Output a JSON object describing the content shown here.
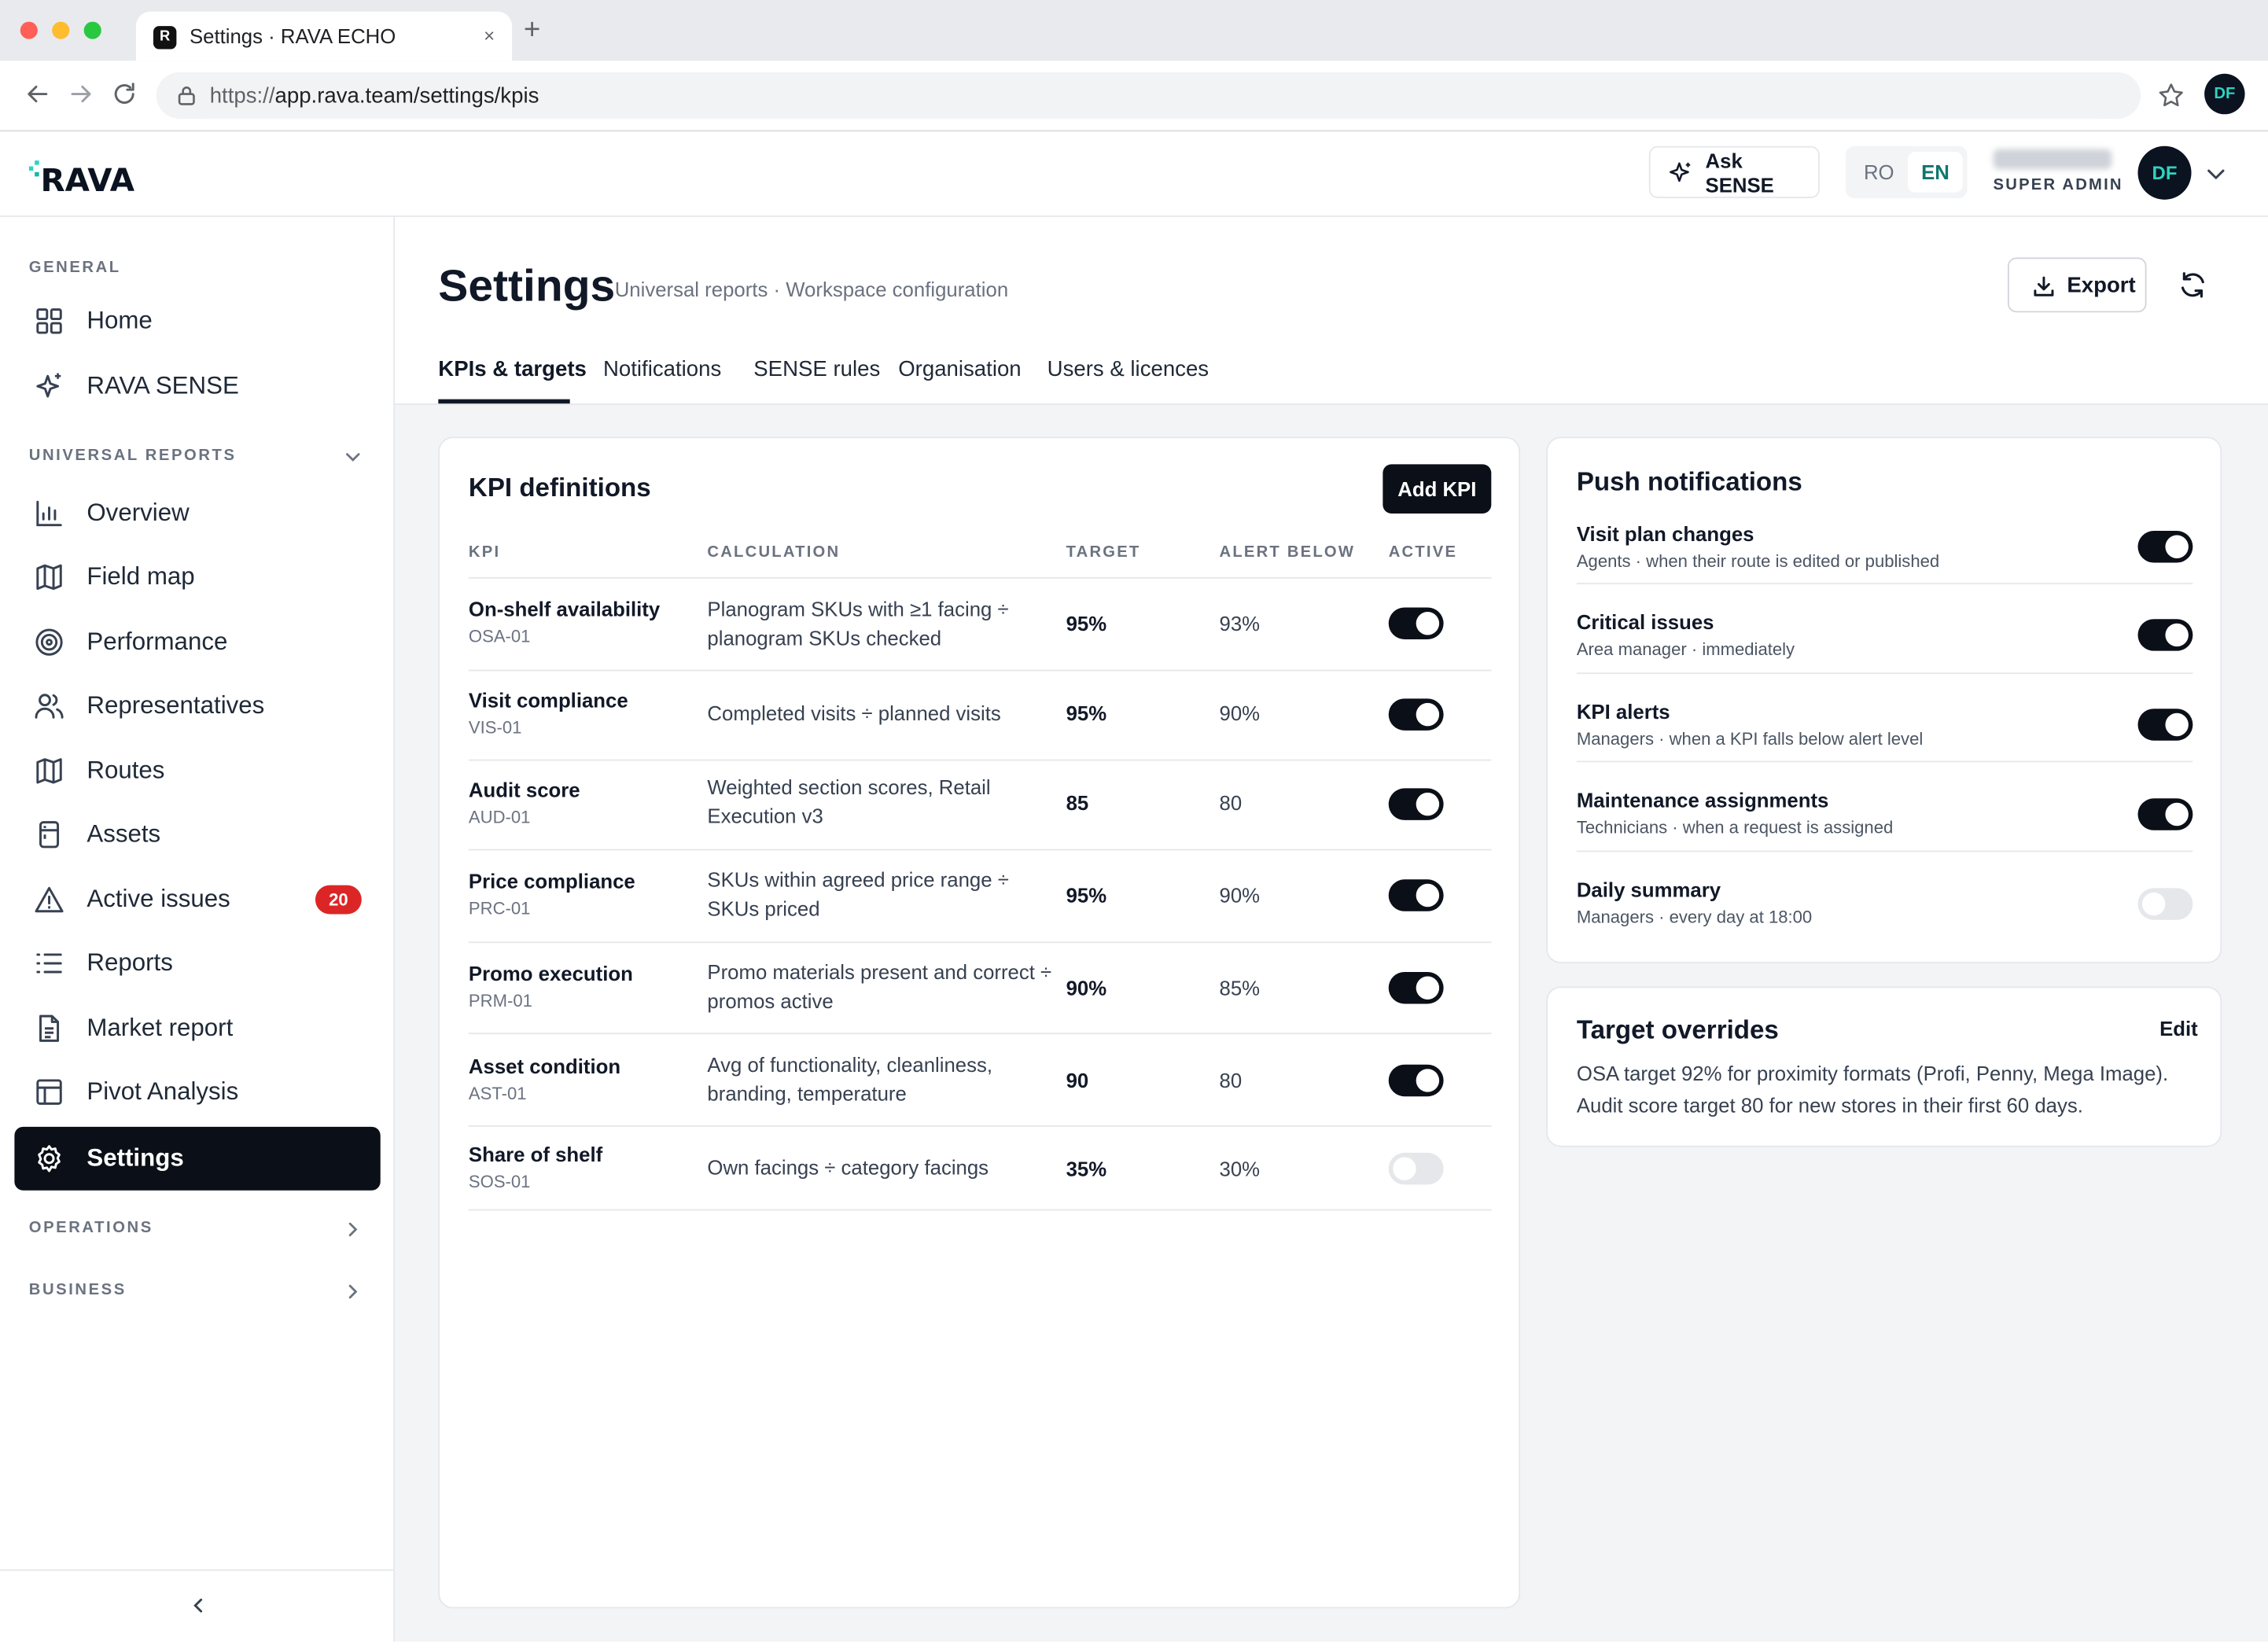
{
  "browser": {
    "tab_title": "Settings · RAVA ECHO",
    "tab_close": "×",
    "new_tab": "+",
    "url_scheme": "https://",
    "url_rest": "app.rava.team/settings/kpis",
    "profile_initials": "DF",
    "favicon_letter": "R"
  },
  "header": {
    "logo_text": "RAVA",
    "ask_line1": "Ask",
    "ask_line2": "SENSE",
    "lang_ro": "RO",
    "lang_en": "EN",
    "user_role": "SUPER ADMIN",
    "avatar_initials": "DF"
  },
  "sidebar": {
    "general_label": "GENERAL",
    "universal_label": "UNIVERSAL REPORTS",
    "operations_label": "OPERATIONS",
    "business_label": "BUSINESS",
    "items": [
      {
        "label": "Home"
      },
      {
        "label": "RAVA SENSE"
      },
      {
        "label": "Overview"
      },
      {
        "label": "Field map"
      },
      {
        "label": "Performance"
      },
      {
        "label": "Representatives"
      },
      {
        "label": "Routes"
      },
      {
        "label": "Assets"
      },
      {
        "label": "Active issues",
        "badge": "20"
      },
      {
        "label": "Reports"
      },
      {
        "label": "Market report"
      },
      {
        "label": "Pivot Analysis"
      },
      {
        "label": "Settings"
      }
    ]
  },
  "page": {
    "title": "Settings",
    "subtitle": "Universal reports · Workspace configuration",
    "export_label": "Export",
    "tabs": [
      {
        "label": "KPIs & targets"
      },
      {
        "label": "Notifications"
      },
      {
        "label": "SENSE rules"
      },
      {
        "label": "Organisation"
      },
      {
        "label": "Users & licences"
      }
    ]
  },
  "kpi": {
    "title": "KPI definitions",
    "add_label": "Add KPI",
    "columns": {
      "kpi": "KPI",
      "calculation": "CALCULATION",
      "target": "TARGET",
      "alert": "ALERT BELOW",
      "active": "ACTIVE"
    },
    "rows": [
      {
        "name": "On-shelf availability",
        "code": "OSA-01",
        "calc": "Planogram SKUs with ≥1 facing ÷ planogram SKUs checked",
        "target": "95%",
        "alert": "93%",
        "active": true
      },
      {
        "name": "Visit compliance",
        "code": "VIS-01",
        "calc": "Completed visits ÷ planned visits",
        "target": "95%",
        "alert": "90%",
        "active": true
      },
      {
        "name": "Audit score",
        "code": "AUD-01",
        "calc": "Weighted section scores, Retail Execution v3",
        "target": "85",
        "alert": "80",
        "active": true
      },
      {
        "name": "Price compliance",
        "code": "PRC-01",
        "calc": "SKUs within agreed price range ÷ SKUs priced",
        "target": "95%",
        "alert": "90%",
        "active": true
      },
      {
        "name": "Promo execution",
        "code": "PRM-01",
        "calc": "Promo materials present and correct ÷ promos active",
        "target": "90%",
        "alert": "85%",
        "active": true
      },
      {
        "name": "Asset condition",
        "code": "AST-01",
        "calc": "Avg of functionality, cleanliness, branding, temperature",
        "target": "90",
        "alert": "80",
        "active": true
      },
      {
        "name": "Share of shelf",
        "code": "SOS-01",
        "calc": "Own facings ÷ category facings",
        "target": "35%",
        "alert": "30%",
        "active": false
      }
    ]
  },
  "push": {
    "title": "Push notifications",
    "items": [
      {
        "title": "Visit plan changes",
        "desc": "Agents · when their route is edited or published",
        "on": true
      },
      {
        "title": "Critical issues",
        "desc": "Area manager · immediately",
        "on": true
      },
      {
        "title": "KPI alerts",
        "desc": "Managers · when a KPI falls below alert level",
        "on": true
      },
      {
        "title": "Maintenance assignments",
        "desc": "Technicians · when a request is assigned",
        "on": true
      },
      {
        "title": "Daily summary",
        "desc": "Managers · every day at 18:00",
        "on": false
      }
    ]
  },
  "overrides": {
    "title": "Target overrides",
    "edit_label": "Edit",
    "text": "OSA target 92% for proximity formats (Profi, Penny, Mega Image). Audit score target 80 for new stores in their first 60 days."
  },
  "colors": {
    "accent": "#0b0f17",
    "brand_teal": "#2dd4bf",
    "danger": "#dc2626"
  }
}
